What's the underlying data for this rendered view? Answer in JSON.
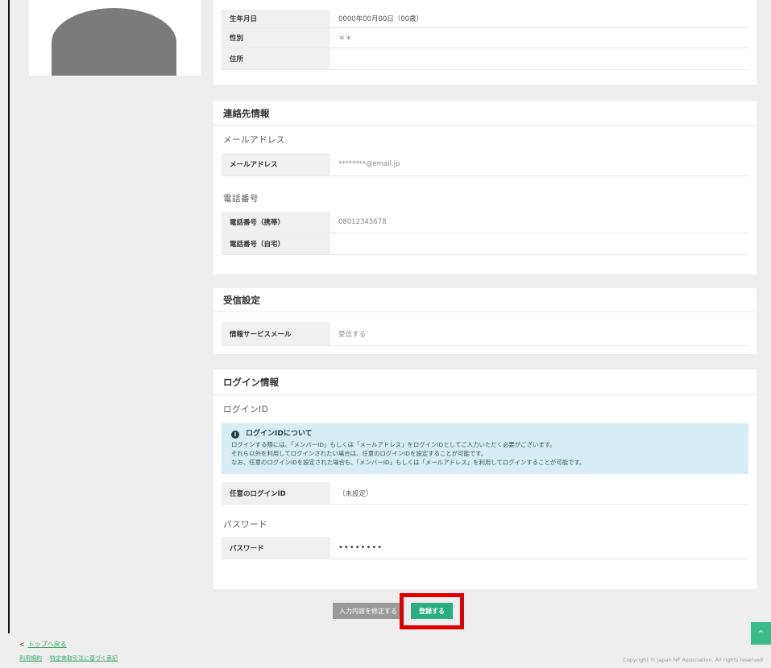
{
  "profile": {
    "rows": [
      {
        "label": "生年月日",
        "value": "0000年00月00日（00歳）"
      },
      {
        "label": "性別",
        "value": "＊＊"
      },
      {
        "label": "住所",
        "value": ""
      }
    ]
  },
  "contact": {
    "title": "連絡先情報",
    "email_section": "メールアドレス",
    "email_label": "メールアドレス",
    "email_value": "********@email.jp",
    "phone_section": "電話番号",
    "mobile_label": "電話番号（携帯）",
    "mobile_value": "08012345678",
    "home_label": "電話番号（自宅）",
    "home_value": ""
  },
  "receive": {
    "title": "受信設定",
    "mail_label": "情報サービスメール",
    "mail_value": "受信する"
  },
  "login": {
    "title": "ログイン情報",
    "id_section": "ログインID",
    "info_title": "ログインIDについて",
    "info_line1": "ログインする際には、「メンバーID」もしくは「メールアドレス」をログインIDとしてご入力いただく必要がございます。",
    "info_line2": "それら以外を利用してログインされたい場合は、任意のログインIDを設定することが可能です。",
    "info_line3": "なお、任意のログインIDを設定された場合も、「メンバーID」もしくは「メールアドレス」を利用してログインすることが可能です。",
    "custom_id_label": "任意のログインID",
    "custom_id_value": "（未設定）",
    "password_section": "パスワード",
    "password_label": "パスワード",
    "password_value": "••••••••"
  },
  "actions": {
    "edit_label": "入力内容を修正する",
    "register_label": "登録する",
    "scroll_top_icon": "chevron-up-icon"
  },
  "footer": {
    "back_label": "トップへ戻る",
    "terms_label": "利用規約",
    "commerce_label": "特定商取引法に基づく表記",
    "copyright": "Copyright © Japan NF Association. All rights reserved"
  },
  "colors": {
    "accent_green": "#2bae82",
    "highlight_red": "#e00000",
    "info_bg": "#d6eef3"
  }
}
